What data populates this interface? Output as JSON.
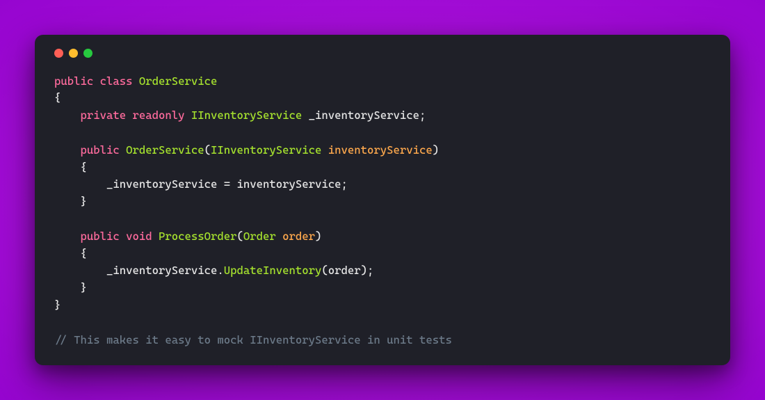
{
  "editor": {
    "window_buttons": {
      "close": "close",
      "minimize": "minimize",
      "maximize": "maximize"
    },
    "code": [
      {
        "indent": 0,
        "tokens": [
          {
            "cls": "tk-keyword",
            "t": "public"
          },
          {
            "cls": "tk-punct",
            "t": " "
          },
          {
            "cls": "tk-keyword",
            "t": "class"
          },
          {
            "cls": "tk-punct",
            "t": " "
          },
          {
            "cls": "tk-type",
            "t": "OrderService"
          }
        ]
      },
      {
        "indent": 0,
        "tokens": [
          {
            "cls": "tk-punct",
            "t": "{"
          }
        ]
      },
      {
        "indent": 1,
        "tokens": [
          {
            "cls": "tk-keyword",
            "t": "private"
          },
          {
            "cls": "tk-punct",
            "t": " "
          },
          {
            "cls": "tk-keyword",
            "t": "readonly"
          },
          {
            "cls": "tk-punct",
            "t": " "
          },
          {
            "cls": "tk-type",
            "t": "IInventoryService"
          },
          {
            "cls": "tk-punct",
            "t": " "
          },
          {
            "cls": "tk-ident",
            "t": "_inventoryService"
          },
          {
            "cls": "tk-punct",
            "t": ";"
          }
        ]
      },
      {
        "indent": 0,
        "tokens": []
      },
      {
        "indent": 1,
        "tokens": [
          {
            "cls": "tk-keyword",
            "t": "public"
          },
          {
            "cls": "tk-punct",
            "t": " "
          },
          {
            "cls": "tk-method",
            "t": "OrderService"
          },
          {
            "cls": "tk-punct",
            "t": "("
          },
          {
            "cls": "tk-type",
            "t": "IInventoryService"
          },
          {
            "cls": "tk-punct",
            "t": " "
          },
          {
            "cls": "tk-param",
            "t": "inventoryService"
          },
          {
            "cls": "tk-punct",
            "t": ")"
          }
        ]
      },
      {
        "indent": 1,
        "tokens": [
          {
            "cls": "tk-punct",
            "t": "{"
          }
        ]
      },
      {
        "indent": 2,
        "tokens": [
          {
            "cls": "tk-ident",
            "t": "_inventoryService"
          },
          {
            "cls": "tk-punct",
            "t": " = "
          },
          {
            "cls": "tk-ident",
            "t": "inventoryService"
          },
          {
            "cls": "tk-punct",
            "t": ";"
          }
        ]
      },
      {
        "indent": 1,
        "tokens": [
          {
            "cls": "tk-punct",
            "t": "}"
          }
        ]
      },
      {
        "indent": 0,
        "tokens": []
      },
      {
        "indent": 1,
        "tokens": [
          {
            "cls": "tk-keyword",
            "t": "public"
          },
          {
            "cls": "tk-punct",
            "t": " "
          },
          {
            "cls": "tk-keyword",
            "t": "void"
          },
          {
            "cls": "tk-punct",
            "t": " "
          },
          {
            "cls": "tk-method",
            "t": "ProcessOrder"
          },
          {
            "cls": "tk-punct",
            "t": "("
          },
          {
            "cls": "tk-type",
            "t": "Order"
          },
          {
            "cls": "tk-punct",
            "t": " "
          },
          {
            "cls": "tk-param",
            "t": "order"
          },
          {
            "cls": "tk-punct",
            "t": ")"
          }
        ]
      },
      {
        "indent": 1,
        "tokens": [
          {
            "cls": "tk-punct",
            "t": "{"
          }
        ]
      },
      {
        "indent": 2,
        "tokens": [
          {
            "cls": "tk-ident",
            "t": "_inventoryService"
          },
          {
            "cls": "tk-punct",
            "t": "."
          },
          {
            "cls": "tk-method",
            "t": "UpdateInventory"
          },
          {
            "cls": "tk-punct",
            "t": "("
          },
          {
            "cls": "tk-ident",
            "t": "order"
          },
          {
            "cls": "tk-punct",
            "t": ");"
          }
        ]
      },
      {
        "indent": 1,
        "tokens": [
          {
            "cls": "tk-punct",
            "t": "}"
          }
        ]
      },
      {
        "indent": 0,
        "tokens": [
          {
            "cls": "tk-punct",
            "t": "}"
          }
        ]
      },
      {
        "indent": 0,
        "tokens": []
      },
      {
        "indent": 0,
        "tokens": [
          {
            "cls": "tk-comment",
            "t": "// This makes it easy to mock IInventoryService in unit tests"
          }
        ]
      }
    ]
  }
}
